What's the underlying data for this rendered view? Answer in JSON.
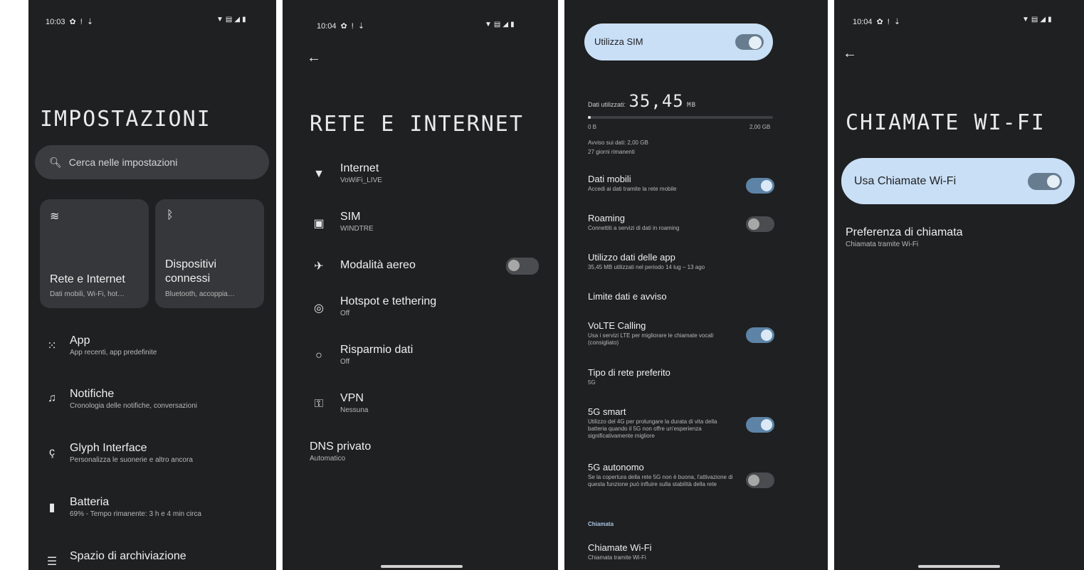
{
  "panel1": {
    "time": "10:03",
    "title": "IMPOSTAZIONI",
    "search_placeholder": "Cerca nelle impostazioni",
    "tiles": [
      {
        "title": "Rete e Internet",
        "subtitle": "Dati mobili, Wi-Fi, hot…",
        "icon": "wifi-icon"
      },
      {
        "title": "Dispositivi connessi",
        "subtitle": "Bluetooth, accoppia…",
        "icon": "bluetooth-icon"
      }
    ],
    "items": [
      {
        "title": "App",
        "subtitle": "App recenti, app predefinite",
        "icon": "apps-grid-icon"
      },
      {
        "title": "Notifiche",
        "subtitle": "Cronologia delle notifiche, conversazioni",
        "icon": "bell-icon"
      },
      {
        "title": "Glyph Interface",
        "subtitle": "Personalizza le suonerie e altro ancora",
        "icon": "glyph-icon"
      },
      {
        "title": "Batteria",
        "subtitle": "69% - Tempo rimanente: 3 h e 4 min circa",
        "icon": "battery-icon"
      },
      {
        "title": "Spazio di archiviazione",
        "subtitle": "",
        "icon": "storage-icon"
      }
    ]
  },
  "panel2": {
    "time": "10:04",
    "title": "RETE E INTERNET",
    "items": [
      {
        "title": "Internet",
        "subtitle": "VoWiFi_LIVE",
        "icon": "wifi-filled-icon"
      },
      {
        "title": "SIM",
        "subtitle": "WINDTRE",
        "icon": "sim-icon"
      },
      {
        "title": "Modalità aereo",
        "subtitle": "",
        "icon": "airplane-icon",
        "toggle": "off"
      },
      {
        "title": "Hotspot e tethering",
        "subtitle": "Off",
        "icon": "hotspot-icon"
      },
      {
        "title": "Risparmio dati",
        "subtitle": "Off",
        "icon": "data-saver-icon"
      },
      {
        "title": "VPN",
        "subtitle": "Nessuna",
        "icon": "vpn-key-icon"
      },
      {
        "title": "DNS privato",
        "subtitle": "Automatico",
        "icon": ""
      }
    ]
  },
  "panel3": {
    "sim_toggle_label": "Utilizza SIM",
    "data_used_label": "Dati utilizzati:",
    "data_used_value": "35,45",
    "data_used_unit": "MB",
    "usage_fraction": 0.017,
    "bar_min": "0 B",
    "bar_max": "2,00 GB",
    "warning": "Avviso sui dati: 2,00 GB",
    "days_left": "27 giorni rimanenti",
    "items": [
      {
        "title": "Dati mobili",
        "subtitle": "Accedi ai dati tramite la rete mobile",
        "toggle": "on"
      },
      {
        "title": "Roaming",
        "subtitle": "Connettiti a servizi di dati in roaming",
        "toggle": "off"
      },
      {
        "title": "Utilizzo dati delle app",
        "subtitle": "35,45 MB utilizzati nel periodo 14 lug – 13 ago",
        "toggle": ""
      },
      {
        "title": "Limite dati e avviso",
        "subtitle": "",
        "toggle": ""
      },
      {
        "title": "VoLTE Calling",
        "subtitle": "Usa i servizi LTE per migliorare le chiamate vocali (consigliato)",
        "toggle": "on"
      },
      {
        "title": "Tipo di rete preferito",
        "subtitle": "5G",
        "toggle": ""
      },
      {
        "title": "5G smart",
        "subtitle": "Utilizzo del 4G per prolungare la durata di vita della batteria quando il 5G non offre un'esperienza significativamente migliore",
        "toggle": "on"
      },
      {
        "title": "5G autonomo",
        "subtitle": "Se la copertura della rete 5G non è buona, l'attivazione di questa funzione può influire sulla stabilità della rete",
        "toggle": "off"
      }
    ],
    "section_header": "Chiamata",
    "wifi_calling_title": "Chiamate Wi-Fi",
    "wifi_calling_subtitle": "Chiamata tramite Wi-Fi"
  },
  "panel4": {
    "time": "10:04",
    "title": "CHIAMATE WI-FI",
    "toggle_label": "Usa Chiamate Wi-Fi",
    "pref_title": "Preferenza di chiamata",
    "pref_subtitle": "Chiamata tramite Wi-Fi"
  },
  "colors": {
    "background": "#1f2022",
    "card": "#35373a",
    "toggle_on": "#5d84a6",
    "highlight_pill": "#c9dff5"
  }
}
